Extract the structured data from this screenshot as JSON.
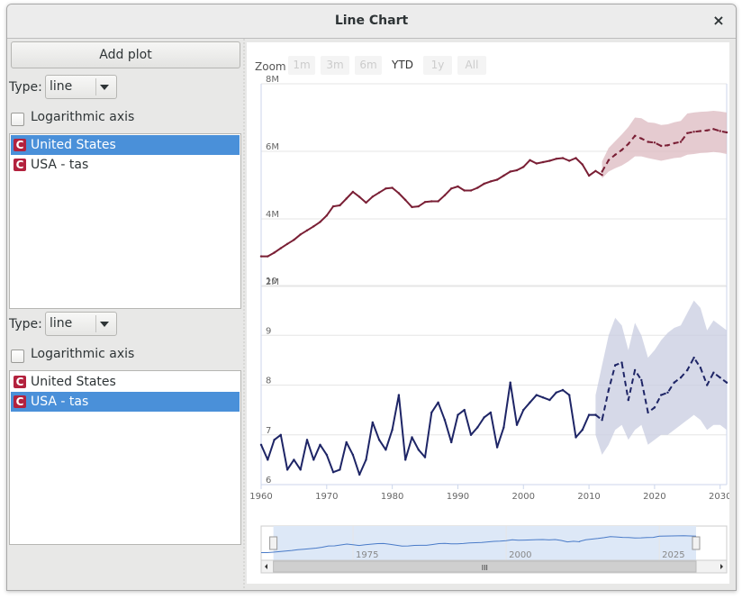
{
  "window": {
    "title": "Line Chart",
    "close_glyph": "×"
  },
  "left_panel": {
    "add_plot_label": "Add plot",
    "panels": [
      {
        "type_label": "Type:",
        "type_value": "line",
        "log_label": "Logarithmic axis",
        "items": [
          {
            "label": "United States",
            "selected": true,
            "icon": "dataset-icon"
          },
          {
            "label": "USA - tas",
            "selected": false,
            "icon": "dataset-icon"
          }
        ]
      },
      {
        "type_label": "Type:",
        "type_value": "line",
        "log_label": "Logarithmic axis",
        "items": [
          {
            "label": "United States",
            "selected": false,
            "icon": "dataset-icon"
          },
          {
            "label": "USA - tas",
            "selected": true,
            "icon": "dataset-icon"
          }
        ]
      }
    ]
  },
  "zoom": {
    "label": "Zoom",
    "buttons": [
      "1m",
      "3m",
      "6m",
      "YTD",
      "1y",
      "All"
    ],
    "active": "YTD"
  },
  "chart_data": [
    {
      "type": "line",
      "title": "",
      "xlabel": "",
      "ylabel": "",
      "x_range": [
        1960,
        2031
      ],
      "ylim": [
        2000000,
        8000000
      ],
      "y_ticks": [
        "8M",
        "6M",
        "4M",
        "2M"
      ],
      "y_tick_values": [
        8000000,
        6000000,
        4000000,
        2000000
      ],
      "grid": true,
      "color": "#7a1f35",
      "band_color": "#dcb9c0",
      "series": [
        {
          "style": "solid",
          "x": [
            1960,
            1961,
            1962,
            1963,
            1964,
            1965,
            1966,
            1967,
            1968,
            1969,
            1970,
            1971,
            1972,
            1973,
            1974,
            1975,
            1976,
            1977,
            1978,
            1979,
            1980,
            1981,
            1982,
            1983,
            1984,
            1985,
            1986,
            1987,
            1988,
            1989,
            1990,
            1991,
            1992,
            1993,
            1994,
            1995,
            1996,
            1997,
            1998,
            1999,
            2000,
            2001,
            2002,
            2003,
            2004,
            2005,
            2006,
            2007,
            2008,
            2009,
            2010,
            2011,
            2012
          ],
          "y": [
            2890000,
            2890000,
            3000000,
            3130000,
            3260000,
            3380000,
            3540000,
            3660000,
            3780000,
            3910000,
            4100000,
            4370000,
            4400000,
            4600000,
            4800000,
            4650000,
            4480000,
            4660000,
            4780000,
            4900000,
            4920000,
            4760000,
            4560000,
            4350000,
            4370000,
            4500000,
            4520000,
            4520000,
            4700000,
            4900000,
            4960000,
            4840000,
            4840000,
            4920000,
            5040000,
            5110000,
            5160000,
            5280000,
            5400000,
            5440000,
            5540000,
            5740000,
            5640000,
            5680000,
            5720000,
            5780000,
            5800000,
            5720000,
            5800000,
            5610000,
            5280000,
            5420000,
            5300000
          ]
        },
        {
          "style": "dashed",
          "x": [
            2012,
            2013,
            2014,
            2015,
            2016,
            2017,
            2018,
            2019,
            2020,
            2021,
            2022,
            2023,
            2024,
            2025,
            2026,
            2027,
            2028,
            2029,
            2030,
            2031
          ],
          "y": [
            5400000,
            5740000,
            5900000,
            6040000,
            6220000,
            6460000,
            6380000,
            6280000,
            6260000,
            6160000,
            6180000,
            6240000,
            6280000,
            6540000,
            6580000,
            6600000,
            6620000,
            6660000,
            6600000,
            6560000
          ],
          "band_low": [
            5200000,
            5400000,
            5500000,
            5580000,
            5700000,
            5850000,
            5850000,
            5800000,
            5760000,
            5720000,
            5760000,
            5800000,
            5820000,
            5900000,
            5920000,
            5950000,
            5960000,
            5980000,
            5960000,
            5920000
          ],
          "band_high": [
            5700000,
            6100000,
            6300000,
            6500000,
            6720000,
            7000000,
            6980000,
            6860000,
            6840000,
            6780000,
            6800000,
            6860000,
            6900000,
            7120000,
            7150000,
            7170000,
            7180000,
            7200000,
            7180000,
            7150000
          ]
        }
      ]
    },
    {
      "type": "line",
      "title": "",
      "xlabel": "",
      "ylabel": "",
      "x_range": [
        1960,
        2031
      ],
      "ylim": [
        6,
        10
      ],
      "y_ticks": [
        "10",
        "9",
        "8",
        "7",
        "6"
      ],
      "y_tick_values": [
        10,
        9,
        8,
        7,
        6
      ],
      "x_ticks": [
        "1960",
        "1970",
        "1980",
        "1990",
        "2000",
        "2010",
        "2020",
        "2030"
      ],
      "x_tick_values": [
        1960,
        1970,
        1980,
        1990,
        2000,
        2010,
        2020,
        2030
      ],
      "grid": true,
      "color": "#1e2566",
      "band_color": "#c8cce0",
      "series": [
        {
          "style": "solid",
          "x": [
            1960,
            1961,
            1962,
            1963,
            1964,
            1965,
            1966,
            1967,
            1968,
            1969,
            1970,
            1971,
            1972,
            1973,
            1974,
            1975,
            1976,
            1977,
            1978,
            1979,
            1980,
            1981,
            1982,
            1983,
            1984,
            1985,
            1986,
            1987,
            1988,
            1989,
            1990,
            1991,
            1992,
            1993,
            1994,
            1995,
            1996,
            1997,
            1998,
            1999,
            2000,
            2001,
            2002,
            2003,
            2004,
            2005,
            2006,
            2007,
            2008,
            2009,
            2010,
            2011
          ],
          "y": [
            6.8,
            6.5,
            6.9,
            7.0,
            6.3,
            6.5,
            6.3,
            6.9,
            6.5,
            6.8,
            6.6,
            6.25,
            6.3,
            6.85,
            6.6,
            6.2,
            6.5,
            7.25,
            6.9,
            6.7,
            7.1,
            7.8,
            6.5,
            6.95,
            6.7,
            6.55,
            7.45,
            7.65,
            7.3,
            6.85,
            7.4,
            7.5,
            7.0,
            7.15,
            7.35,
            7.45,
            6.75,
            7.15,
            8.05,
            7.2,
            7.5,
            7.65,
            7.8,
            7.75,
            7.7,
            7.85,
            7.9,
            7.8,
            6.95,
            7.1,
            7.4,
            7.4
          ]
        },
        {
          "style": "dashed",
          "x": [
            2011,
            2012,
            2013,
            2014,
            2015,
            2016,
            2017,
            2018,
            2019,
            2020,
            2021,
            2022,
            2023,
            2024,
            2025,
            2026,
            2027,
            2028,
            2029,
            2030,
            2031
          ],
          "y": [
            7.4,
            7.3,
            7.9,
            8.4,
            8.45,
            7.7,
            8.3,
            8.1,
            7.45,
            7.55,
            7.8,
            7.85,
            8.05,
            8.15,
            8.3,
            8.55,
            8.35,
            8.0,
            8.25,
            8.15,
            8.05
          ],
          "band_low": [
            7.0,
            6.6,
            6.8,
            7.1,
            7.2,
            6.9,
            7.1,
            7.2,
            6.8,
            6.9,
            7.0,
            7.0,
            7.1,
            7.2,
            7.3,
            7.4,
            7.3,
            7.1,
            7.2,
            7.2,
            7.1
          ],
          "band_high": [
            7.8,
            8.4,
            9.0,
            9.35,
            9.2,
            8.7,
            9.25,
            9.0,
            8.55,
            8.7,
            8.9,
            9.05,
            9.15,
            9.2,
            9.45,
            9.7,
            9.55,
            9.1,
            9.3,
            9.2,
            9.1
          ]
        }
      ]
    }
  ],
  "navigator": {
    "x_ticks": [
      "1975",
      "2000",
      "2025"
    ],
    "x_tick_values": [
      1975,
      2000,
      2025
    ],
    "x_range": [
      1960,
      2036
    ],
    "selected_range": [
      1962,
      2031
    ],
    "scrollbar_grip": "III"
  }
}
